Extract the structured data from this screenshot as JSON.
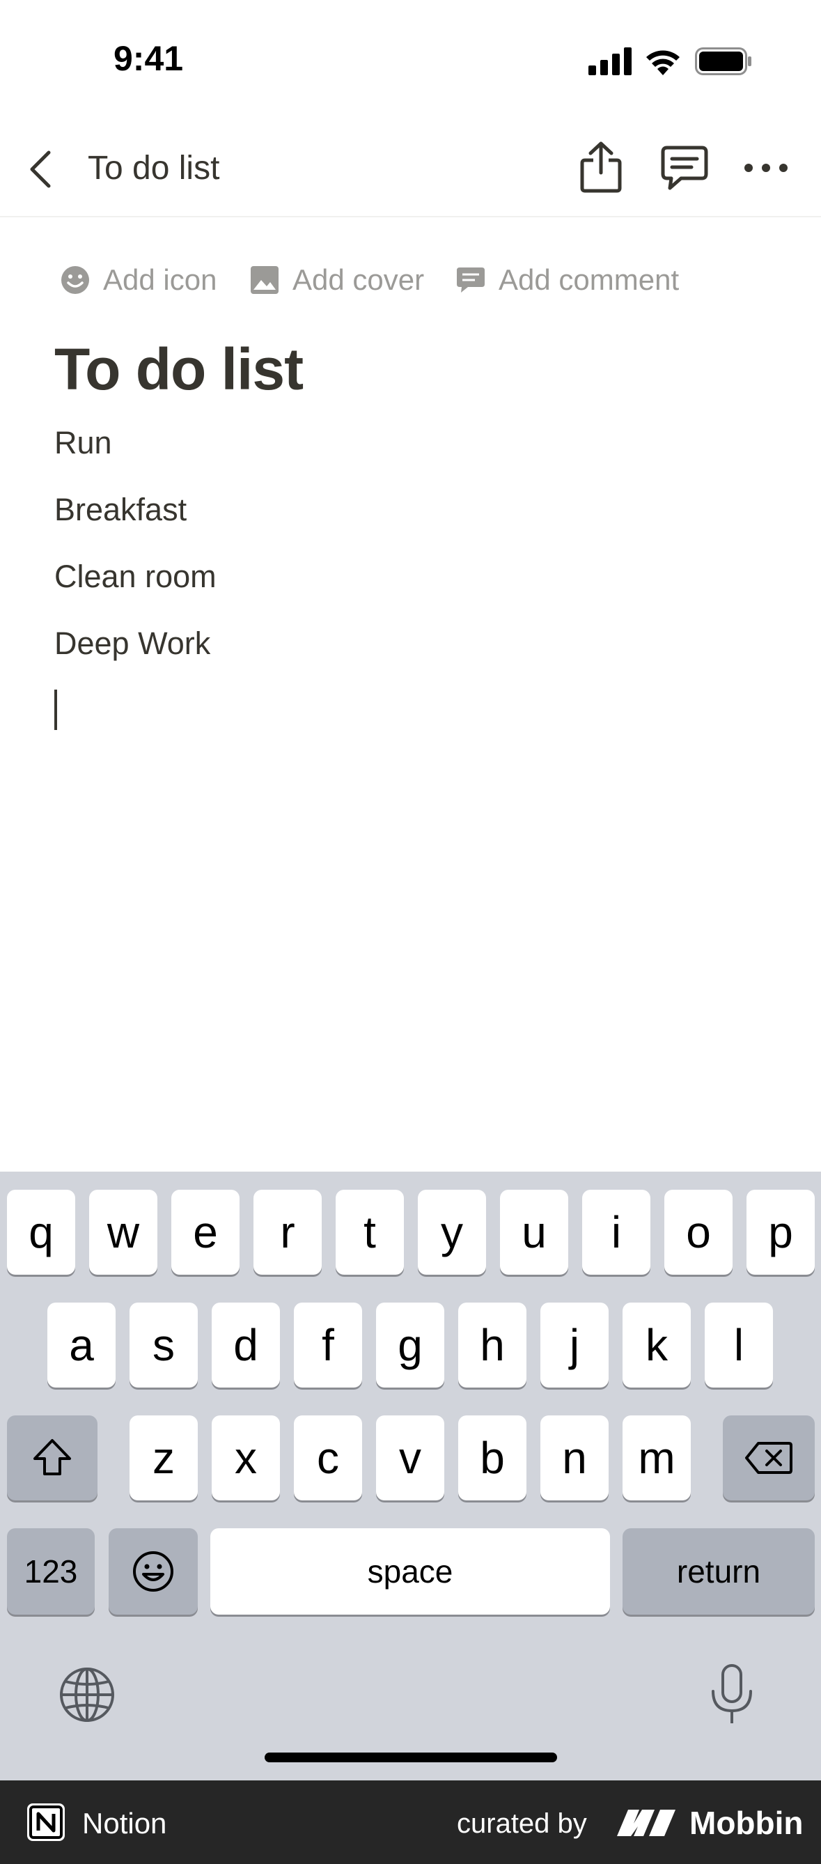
{
  "status": {
    "time": "9:41"
  },
  "nav": {
    "title": "To do list"
  },
  "actions": {
    "add_icon": "Add icon",
    "add_cover": "Add cover",
    "add_comment": "Add comment"
  },
  "page": {
    "title": "To do list",
    "blocks": [
      "Run",
      "Breakfast",
      "Clean room",
      "Deep Work"
    ]
  },
  "keyboard": {
    "row1": [
      "q",
      "w",
      "e",
      "r",
      "t",
      "y",
      "u",
      "i",
      "o",
      "p"
    ],
    "row2": [
      "a",
      "s",
      "d",
      "f",
      "g",
      "h",
      "j",
      "k",
      "l"
    ],
    "row3": [
      "z",
      "x",
      "c",
      "v",
      "b",
      "n",
      "m"
    ],
    "numbers": "123",
    "space": "space",
    "return": "return"
  },
  "footer": {
    "app": "Notion",
    "curated_by": "curated by",
    "brand": "Mobbin"
  },
  "icons": [
    "signal-icon",
    "wifi-icon",
    "battery-icon",
    "back-icon",
    "share-icon",
    "comments-icon",
    "more-icon",
    "smiley-icon",
    "image-icon",
    "comment-icon",
    "shift-icon",
    "delete-icon",
    "emoji-icon",
    "globe-icon",
    "microphone-icon"
  ]
}
